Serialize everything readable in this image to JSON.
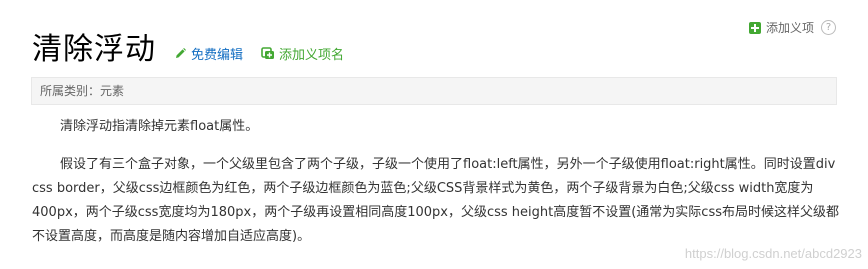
{
  "header": {
    "add_item_label": "添加义项",
    "help_symbol": "?"
  },
  "title": {
    "text": "清除浮动",
    "edit_label": "免费编辑",
    "add_name_label": "添加义项名"
  },
  "category": {
    "text": "所属类别：元素"
  },
  "content": {
    "paragraphs": [
      "清除浮动指清除掉元素float属性。",
      "假设了有三个盒子对象，一个父级里包含了两个子级，子级一个使用了float:left属性，另外一个子级使用float:right属性。同时设置div css border，父级css边框颜色为红色，两个子级边框颜色为蓝色;父级CSS背景样式为黄色，两个子级背景为白色;父级css width宽度为400px，两个子级css宽度均为180px，两个子级再设置相同高度100px，父级css height高度暂不设置(通常为实际css布局时候这样父级都不设置高度，而高度是随内容增加自适应高度)。"
    ]
  },
  "watermark": "https://blog.csdn.net/abcd2923",
  "colors": {
    "link_blue": "#136ec2",
    "green": "#43a833"
  },
  "icons": {
    "add": "plus-square-icon",
    "help": "help-icon",
    "edit": "pencil-icon",
    "add_name": "add-name-icon"
  }
}
